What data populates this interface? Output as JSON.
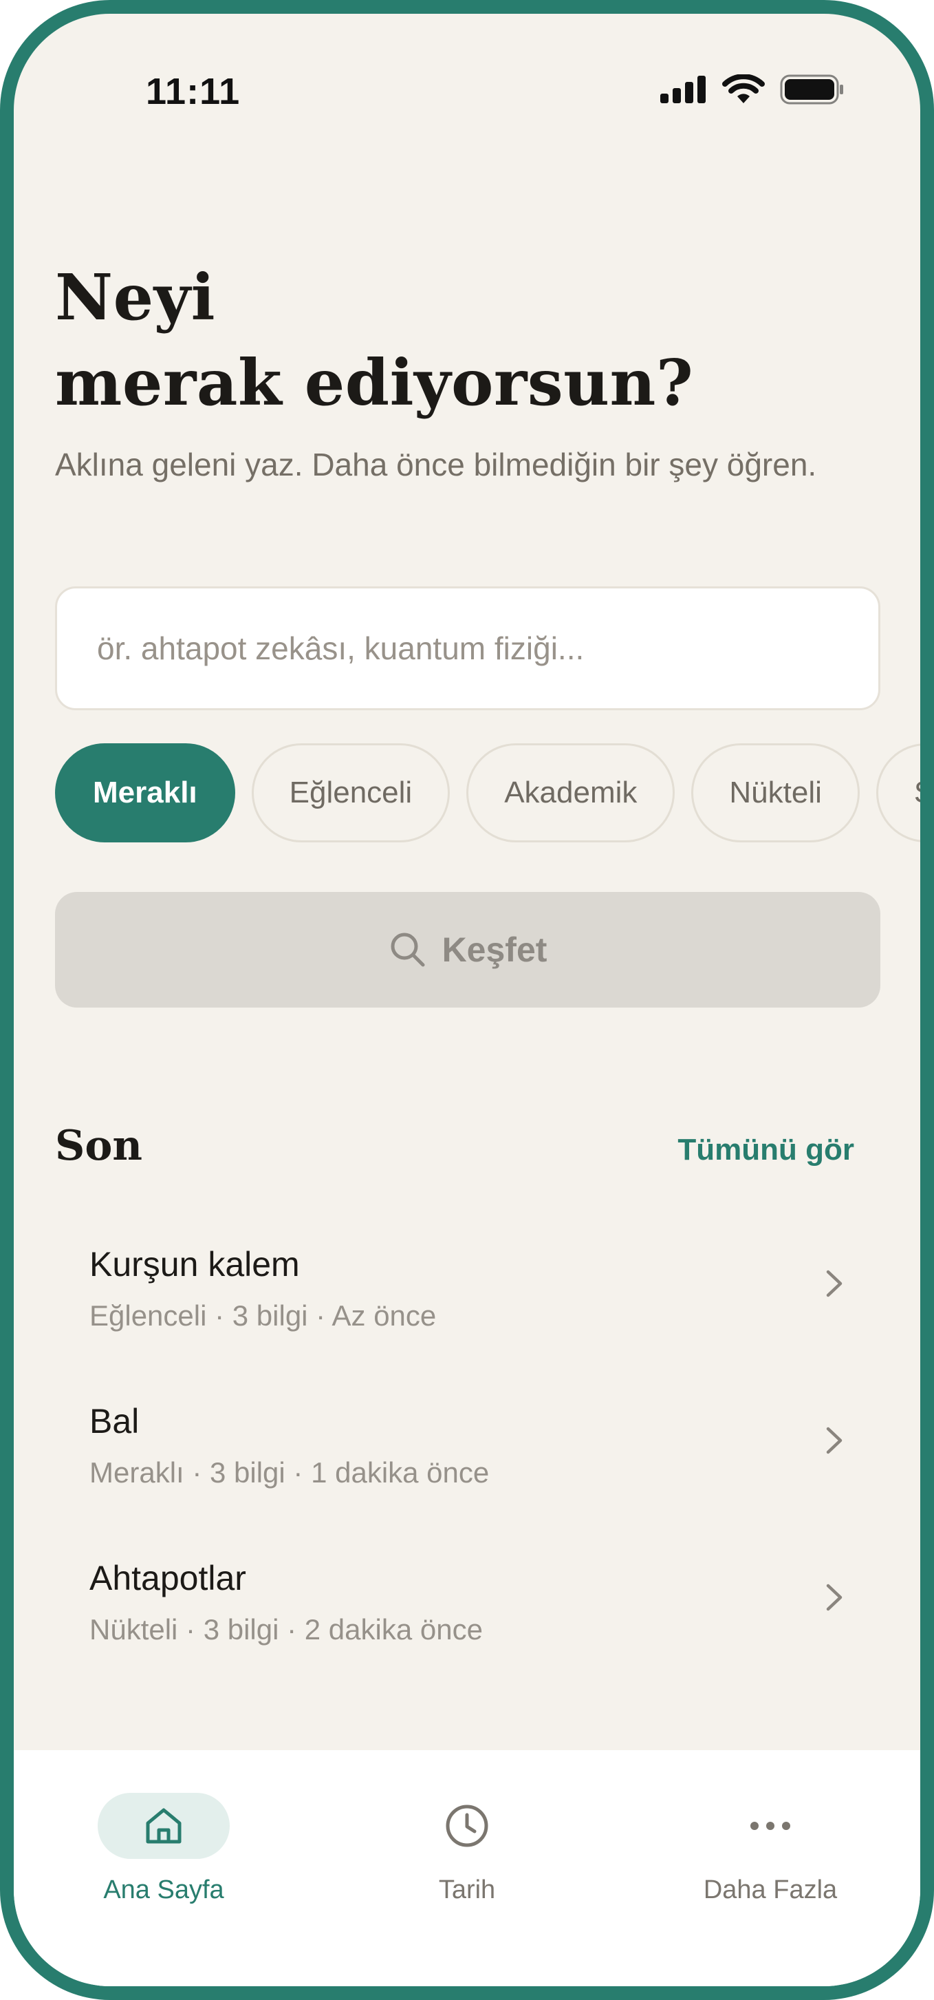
{
  "status_bar": {
    "time": "11:11"
  },
  "header": {
    "title_line1": "Neyi",
    "title_line2": "merak ediyorsun?",
    "subtitle": "Aklına geleni yaz. Daha önce bilmediğin bir şey öğren."
  },
  "search": {
    "placeholder": "ör. ahtapot zekâsı, kuantum fiziği...",
    "value": ""
  },
  "tones": {
    "selected": "Meraklı",
    "items": [
      {
        "label": "Meraklı",
        "active": true
      },
      {
        "label": "Eğlenceli",
        "active": false
      },
      {
        "label": "Akademik",
        "active": false
      },
      {
        "label": "Nükteli",
        "active": false
      },
      {
        "label": "Şiirsel",
        "active": false
      }
    ]
  },
  "discover": {
    "label": "Keşfet",
    "icon": "search-icon"
  },
  "recent": {
    "title": "Son",
    "see_all": "Tümünü gör",
    "items": [
      {
        "title": "Kurşun kalem",
        "meta": "Eğlenceli · 3 bilgi · Az önce"
      },
      {
        "title": "Bal",
        "meta": "Meraklı · 3 bilgi · 1 dakika önce"
      },
      {
        "title": "Ahtapotlar",
        "meta": "Nükteli · 3 bilgi · 2 dakika önce"
      }
    ]
  },
  "nav": {
    "items": [
      {
        "label": "Ana Sayfa",
        "icon": "home-icon",
        "active": true
      },
      {
        "label": "Tarih",
        "icon": "clock-icon",
        "active": false
      },
      {
        "label": "Daha Fazla",
        "icon": "more-dots-icon",
        "active": false
      }
    ]
  },
  "colors": {
    "accent": "#287d6e",
    "background": "#f5f2ec",
    "button_disabled": "#dbd8d2"
  }
}
